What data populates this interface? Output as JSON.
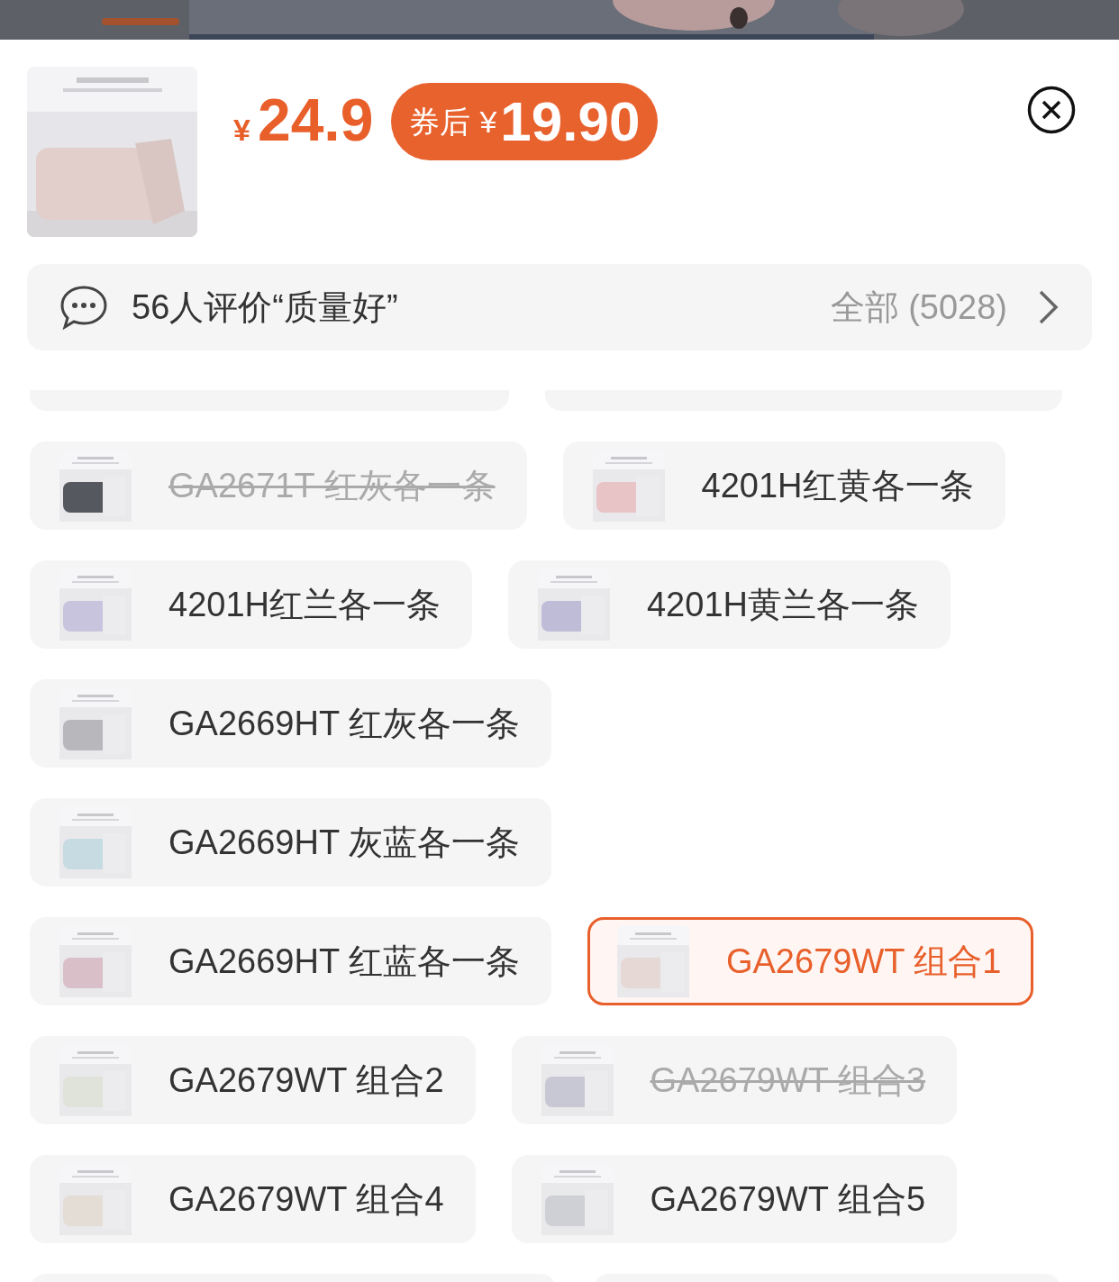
{
  "price": {
    "currency": "¥",
    "amount": "24.9"
  },
  "coupon": {
    "label": "券后",
    "currency": "¥",
    "amount": "19.90"
  },
  "reviews": {
    "summary": "56人评价“质量好”",
    "all": "全部 (5028)"
  },
  "options": [
    {
      "kind": "partial_top"
    },
    {
      "kind": "partial_top"
    },
    {
      "kind": "chip",
      "label": "GA2671T 红灰各一条",
      "selected": false,
      "disabled": true,
      "color": "#55585e"
    },
    {
      "kind": "chip",
      "label": "4201H红黄各一条",
      "selected": false,
      "disabled": false,
      "color": "#e8c4c6"
    },
    {
      "kind": "chip",
      "label": "4201H红兰各一条",
      "selected": false,
      "disabled": false,
      "color": "#c9c4de"
    },
    {
      "kind": "chip",
      "label": "4201H黄兰各一条",
      "selected": false,
      "disabled": false,
      "color": "#bfbcd8"
    },
    {
      "kind": "chip",
      "label": "GA2669HT 红灰各一条",
      "selected": false,
      "disabled": false,
      "color": "#b8b8bc"
    },
    {
      "kind": "chip",
      "label": "GA2669HT 灰蓝各一条",
      "selected": false,
      "disabled": false,
      "color": "#c7dbe3"
    },
    {
      "kind": "chip",
      "label": "GA2669HT 红蓝各一条",
      "selected": false,
      "disabled": false,
      "color": "#d9c0c8"
    },
    {
      "kind": "chip",
      "label": "GA2679WT 组合1",
      "selected": true,
      "disabled": false,
      "color": "#e6d8d4"
    },
    {
      "kind": "chip",
      "label": "GA2679WT 组合2",
      "selected": false,
      "disabled": false,
      "color": "#dfe3da"
    },
    {
      "kind": "chip",
      "label": "GA2679WT 组合3",
      "selected": false,
      "disabled": true,
      "color": "#c8c8d4"
    },
    {
      "kind": "chip",
      "label": "GA2679WT 组合4",
      "selected": false,
      "disabled": false,
      "color": "#e3ddd6"
    },
    {
      "kind": "chip",
      "label": "GA2679WT 组合5",
      "selected": false,
      "disabled": false,
      "color": "#cfcfd6"
    },
    {
      "kind": "partial_bottom"
    },
    {
      "kind": "partial_bottom"
    }
  ]
}
